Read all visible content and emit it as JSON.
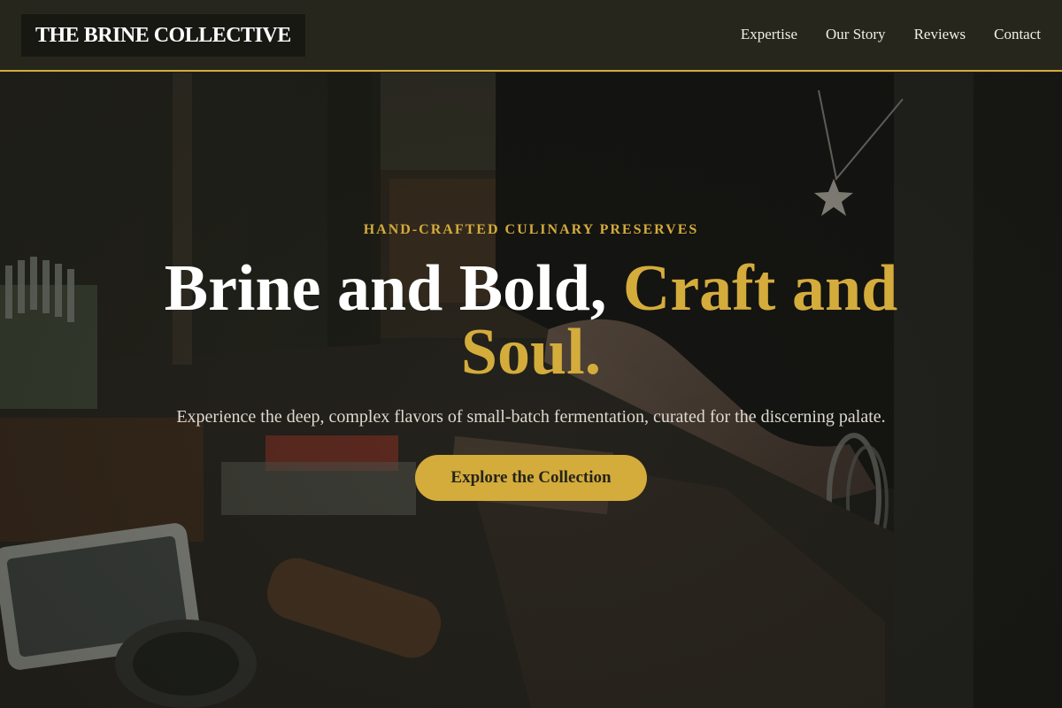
{
  "header": {
    "logo": "THE BRINE COLLECTIVE",
    "nav": [
      {
        "label": "Expertise"
      },
      {
        "label": "Our Story"
      },
      {
        "label": "Reviews"
      },
      {
        "label": "Contact"
      }
    ]
  },
  "hero": {
    "eyebrow": "HAND-CRAFTED CULINARY PRESERVES",
    "headline_main": "Brine and Bold, ",
    "headline_accent": "Craft and Soul.",
    "subtitle": "Experience the deep, complex flavors of small-batch fermentation, curated for the discerning palate.",
    "cta_label": "Explore the Collection"
  },
  "colors": {
    "accent": "#d4ac3c",
    "header_bg": "#26261c",
    "logo_bg": "#181813",
    "text_light": "#ffffff",
    "button_text": "#26241a"
  }
}
